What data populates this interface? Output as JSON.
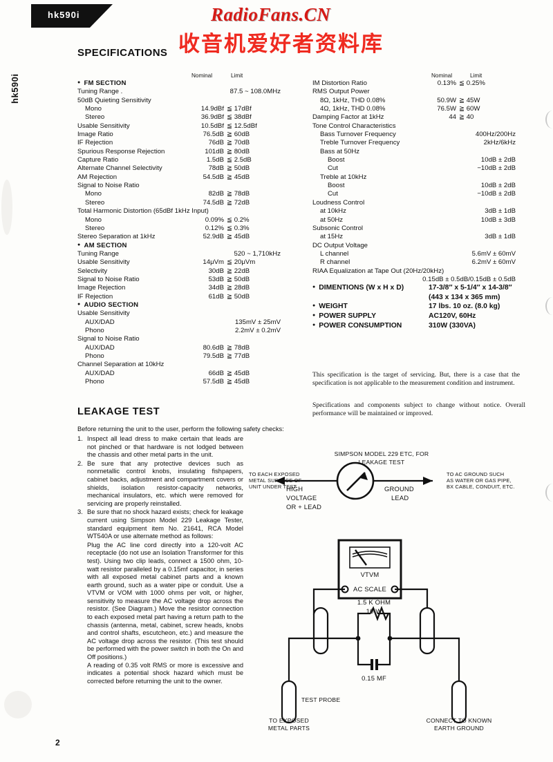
{
  "header": {
    "model_tab": "hk590i",
    "side_tab": "hk590i",
    "watermark_latin": "RadioFans.CN",
    "watermark_cjk": "收音机爱好者资料库",
    "section_title": "SPECIFICATIONS"
  },
  "page_number": "2",
  "columns": {
    "nominal": "Nominal",
    "limit": "Limit"
  },
  "fm_section": {
    "heading": "FM SECTION",
    "rows": [
      {
        "label": "Tuning Range  .",
        "wide": "87.5 ~ 108.0MHz",
        "indent": 0
      },
      {
        "label": "50dB Quieting Sensitivity",
        "indent": 0
      },
      {
        "label": "Mono",
        "nominal": "14.9dBf",
        "limit": "≦ 17dBf",
        "indent": 1
      },
      {
        "label": "Stereo",
        "nominal": "36.9dBf",
        "limit": "≦ 38dBf",
        "indent": 1
      },
      {
        "label": "Usable Sensitivity",
        "nominal": "10.5dBf",
        "limit": "≦ 12.5dBf",
        "indent": 0
      },
      {
        "label": "Image Ratio",
        "nominal": "76.5dB",
        "limit": "≧ 60dB",
        "indent": 0
      },
      {
        "label": "IF Rejection",
        "nominal": "76dB",
        "limit": "≧ 70dB",
        "indent": 0
      },
      {
        "label": "Spurious Response Rejection",
        "nominal": "101dB",
        "limit": "≧ 80dB",
        "indent": 0
      },
      {
        "label": "Capture Ratio",
        "nominal": "1.5dB",
        "limit": "≦ 2.5dB",
        "indent": 0
      },
      {
        "label": "Alternate Channel Selectivity",
        "nominal": "78dB",
        "limit": "≧ 50dB",
        "indent": 0
      },
      {
        "label": "AM Rejection",
        "nominal": "54.5dB",
        "limit": "≧ 45dB",
        "indent": 0
      },
      {
        "label": "Signal to Noise Ratio",
        "indent": 0
      },
      {
        "label": "Mono",
        "nominal": "82dB",
        "limit": "≧ 78dB",
        "indent": 1
      },
      {
        "label": "Stereo",
        "nominal": "74.5dB",
        "limit": "≧ 72dB",
        "indent": 1
      },
      {
        "label": "Total Harmonic Distortion (65dBf 1kHz Input)",
        "indent": 0
      },
      {
        "label": "Mono",
        "nominal": "0.09%",
        "limit": "≦ 0.2%",
        "indent": 1
      },
      {
        "label": "Stereo",
        "nominal": "0.12%",
        "limit": "≦ 0.3%",
        "indent": 1
      },
      {
        "label": "Stereo Separation at 1kHz",
        "nominal": "52.9dB",
        "limit": "≧ 45dB",
        "indent": 0
      }
    ]
  },
  "am_section": {
    "heading": "AM SECTION",
    "rows": [
      {
        "label": "Tuning Range",
        "wide": "520 ~ 1,710kHz",
        "indent": 0
      },
      {
        "label": "Usable Sensitivity",
        "nominal": "14μVm",
        "limit": "≦ 20μVm",
        "indent": 0
      },
      {
        "label": "Selectivity",
        "nominal": "30dB",
        "limit": "≧ 22dB",
        "indent": 0
      },
      {
        "label": "Signal to Noise Ratio",
        "nominal": "53dB",
        "limit": "≧ 50dB",
        "indent": 0
      },
      {
        "label": "Image Rejection",
        "nominal": "34dB",
        "limit": "≧ 28dB",
        "indent": 0
      },
      {
        "label": "IF Rejection",
        "nominal": "61dB",
        "limit": "≧ 50dB",
        "indent": 0
      }
    ]
  },
  "audio_section": {
    "heading": "AUDIO SECTION",
    "rows": [
      {
        "label": "Usable Sensitivity",
        "indent": 0
      },
      {
        "label": "AUX/DAD",
        "wide": "135mV ± 25mV",
        "indent": 1
      },
      {
        "label": "Phono",
        "wide": "2.2mV ± 0.2mV",
        "indent": 1
      },
      {
        "label": "Signal to Noise Ratio",
        "indent": 0
      },
      {
        "label": "AUX/DAD",
        "nominal": "80.6dB",
        "limit": "≧ 78dB",
        "indent": 1
      },
      {
        "label": "Phono",
        "nominal": "79.5dB",
        "limit": "≧ 77dB",
        "indent": 1
      },
      {
        "label": "Channel Separation at 10kHz",
        "indent": 0
      },
      {
        "label": "AUX/DAD",
        "nominal": "66dB",
        "limit": "≧ 45dB",
        "indent": 1
      },
      {
        "label": "Phono",
        "nominal": "57.5dB",
        "limit": "≧ 45dB",
        "indent": 1
      }
    ]
  },
  "right_section": {
    "rows": [
      {
        "label": "IM Distortion Ratio",
        "nominal": "0.13%",
        "limit": "≦ 0.25%",
        "indent": 0
      },
      {
        "label": "RMS Output Power",
        "indent": 0
      },
      {
        "label": "8Ω, 1kHz, THD 0.08%",
        "nominal": "50.9W",
        "limit": "≧ 45W",
        "indent": 1
      },
      {
        "label": "4Ω, 1kHz, THD 0.08%",
        "nominal": "76.5W",
        "limit": "≧ 60W",
        "indent": 1
      },
      {
        "label": "Damping Factor at 1kHz",
        "nominal": "44",
        "limit": "≧ 40",
        "indent": 0
      },
      {
        "label": "Tone Control Characteristics",
        "indent": 0
      },
      {
        "label": "Bass Turnover Frequency",
        "wide": "400Hz/200Hz",
        "indent": 1
      },
      {
        "label": "Treble Turnover Frequency",
        "wide": "2kHz/6kHz",
        "indent": 1
      },
      {
        "label": "Bass at 50Hz",
        "indent": 1
      },
      {
        "label": "Boost",
        "wide": "10dB ± 2dB",
        "indent": 2
      },
      {
        "label": "Cut",
        "wide": "−10dB ± 2dB",
        "indent": 2
      },
      {
        "label": "Treble at 10kHz",
        "indent": 1
      },
      {
        "label": "Boost",
        "wide": "10dB ± 2dB",
        "indent": 2
      },
      {
        "label": "Cut",
        "wide": "−10dB ± 2dB",
        "indent": 2
      },
      {
        "label": "Loudness Control",
        "indent": 0
      },
      {
        "label": "at 10kHz",
        "wide": "3dB ± 1dB",
        "indent": 1
      },
      {
        "label": "at 50Hz",
        "wide": "10dB ± 3dB",
        "indent": 1
      },
      {
        "label": "Subsonic Control",
        "indent": 0
      },
      {
        "label": "at 15Hz",
        "wide": "3dB ± 1dB",
        "indent": 1
      },
      {
        "label": "DC Output Voltage",
        "indent": 0
      },
      {
        "label": "L channel",
        "wide": "5.6mV ± 60mV",
        "indent": 1
      },
      {
        "label": "R channel",
        "wide": "6.2mV ± 60mV",
        "indent": 1
      },
      {
        "label": "RIAA Equalization at Tape Out (20Hz/20kHz)",
        "indent": 0
      },
      {
        "label": "",
        "wide": "0.15dB ± 0.5dB/0.15dB ± 0.5dB",
        "indent": 0
      }
    ],
    "big_items": [
      {
        "label": "DIMENTIONS (W x H x D)",
        "value": "17-3/8″ x 5-1/4″ x 14-3/8″",
        "inline": true
      },
      {
        "label": "",
        "value": "(443 x 134 x 365 mm)",
        "inline": false
      },
      {
        "label": "WEIGHT",
        "value": "17 lbs. 10 oz. (8.0 kg)",
        "inline": false
      },
      {
        "label": "POWER SUPPLY",
        "value": "AC120V, 60Hz",
        "inline": false
      },
      {
        "label": "POWER CONSUMPTION",
        "value": "310W (330VA)",
        "inline": false
      }
    ],
    "note1": "This specification is the target of servicing. But, there is a case that the specification is not applicable to the measurement condition and instrument.",
    "note2": "Specifications and components subject to change without notice. Overall performance will be maintained or improved."
  },
  "leakage": {
    "title": "LEAKAGE  TEST",
    "intro": "Before returning the unit to the user, perform the following safety checks:",
    "items": [
      {
        "num": "1.",
        "text": "Inspect all lead dress to make certain that leads are not pinched or that hardware is not lodged between the chassis and other metal parts in the unit."
      },
      {
        "num": "2.",
        "text": "Be sure that any protective devices such as nonmetallic control knobs, insulating fishpapers, cabinet backs, adjustment and compartment covers or shields, isolation resistor-capacity networks, mechanical insulators, etc. which were removed for servicing are properly reinstalled."
      },
      {
        "num": "3.",
        "text": "Be sure that no shock hazard exists; check for leakage current using Simpson Model 229 Leakage Tester, standard equipment item No. 21641, RCA Model WT540A or use alternate method as follows:"
      }
    ],
    "sub_paragraphs": [
      "Plug the AC line cord directly into a 120-volt AC receptacle (do not use an Isolation Transformer for this test). Using two clip leads, connect a 1500 ohm, 10-watt resistor paralleled by a 0.15mf capacitor, in series with all exposed metal cabinet parts and a known earth ground, such as a water pipe or conduit. Use a VTVM or VOM with 1000 ohms per volt, or higher, sensitivity to measure the AC voltage drop across the resistor. (See Diagram.) Move the resistor connection to each exposed metal part having a return path to the chassis (antenna, metal, cabinet, screw heads, knobs and control shafts, escutcheon, etc.) and measure the AC voltage drop across the resistor. (This test should be performed with the power switch in both the On and Off positions.)",
      "A reading of 0.35 volt RMS or more is excessive and indicates a potential shock hazard which must be corrected before returning the unit to the owner."
    ]
  },
  "diagram": {
    "meter_caption_line1": "SIMPSON MODEL 229 ETC, FOR",
    "meter_caption_line2": "LEAKAGE TEST",
    "left_note_line1": "TO EACH EXPOSED",
    "left_note_line2": "METAL SURFACE OF",
    "left_note_line3": "UNIT UNDER TEST",
    "right_note_line1": "TO AC GROUND SUCH",
    "right_note_line2": "AS WATER OR GAS PIPE,",
    "right_note_line3": "BX CABLE, CONDUIT, ETC.",
    "high_voltage_line1": "HIGH",
    "high_voltage_line2": "VOLTAGE",
    "high_voltage_line3": "OR + LEAD",
    "ground_line1": "GROUND",
    "ground_line2": "LEAD",
    "vtvm_label": "VTVM",
    "ac_scale_label": "AC SCALE",
    "resistor_value_line1": "1.5 K OHM",
    "resistor_value_line2": "10 W",
    "capacitor_value": "0.15 MF",
    "test_probe_label": "TEST PROBE",
    "bottom_left_line1": "TO EXPOSED",
    "bottom_left_line2": "METAL PARTS",
    "bottom_right_line1": "CONNECT TO KNOWN",
    "bottom_right_line2": "EARTH GROUND"
  }
}
